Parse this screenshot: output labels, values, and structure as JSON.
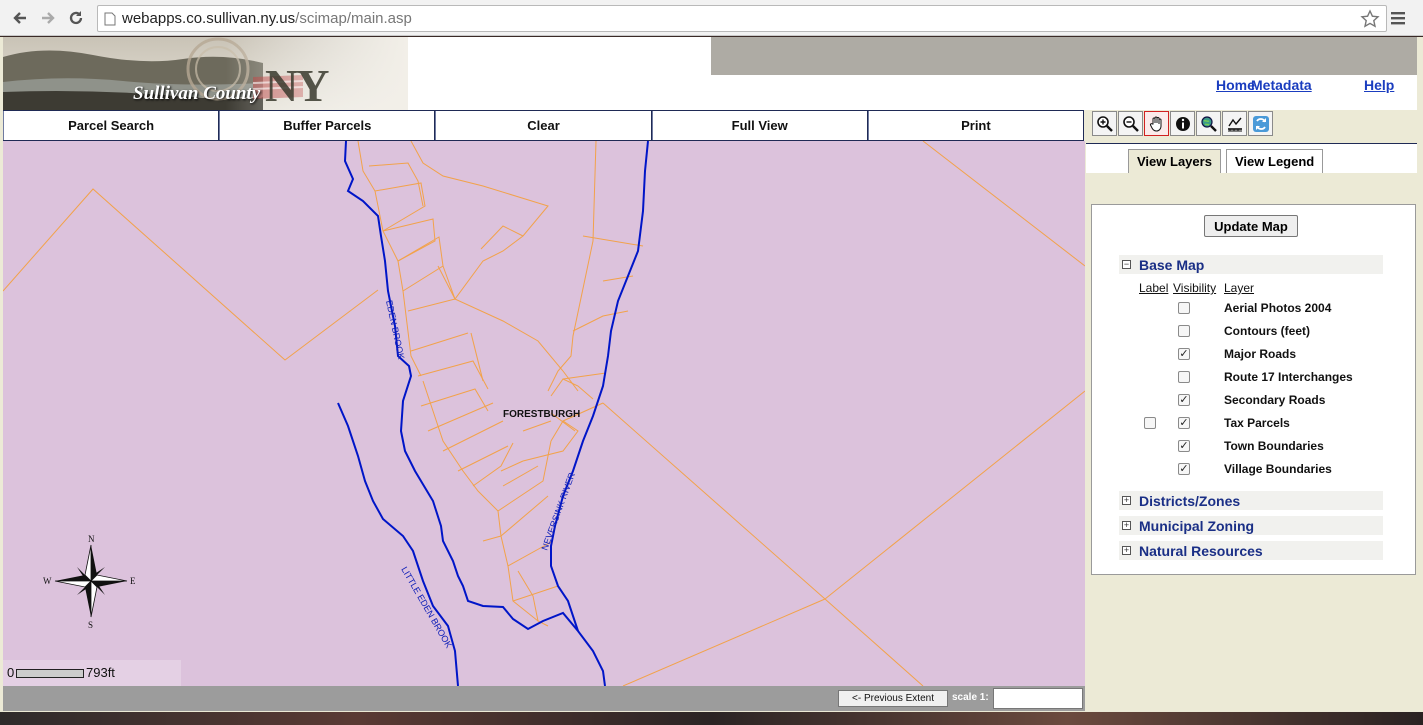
{
  "browser": {
    "url_host": "webapps.co.sullivan.ny.us",
    "url_path": "/scimap/main.asp"
  },
  "header": {
    "banner_text": "Sullivan County",
    "banner_ny": "NY",
    "links": [
      "Home",
      "Metadata",
      "Help"
    ]
  },
  "toolbar": {
    "buttons": [
      "Parcel Search",
      "Buffer Parcels",
      "Clear",
      "Full View",
      "Print"
    ]
  },
  "map": {
    "place_label": "FORESTBURGH",
    "streams": [
      "EDEN BROOK",
      "NEVERSINK RIVER",
      "LITTLE EDEN BROOK"
    ],
    "compass": {
      "n": "N",
      "s": "S",
      "e": "E",
      "w": "W"
    },
    "scalebar": {
      "start": "0",
      "end": "793ft"
    }
  },
  "bottom": {
    "prev_extent_label": "<- Previous Extent",
    "scale_label": "scale 1:",
    "scale_value": ""
  },
  "panel": {
    "tools": [
      "zoom-in",
      "zoom-out",
      "pan",
      "identify",
      "query",
      "measure",
      "refresh"
    ],
    "tabs": [
      "View Layers",
      "View Legend"
    ],
    "update_label": "Update Map",
    "base_map": {
      "title": "Base Map",
      "col_label": "Label",
      "col_visibility": "Visibility",
      "col_layer": "Layer",
      "layers": [
        {
          "name": "Aerial Photos 2004",
          "label": false,
          "visible": false
        },
        {
          "name": "Contours (feet)",
          "label": false,
          "visible": false
        },
        {
          "name": "Major Roads",
          "label": false,
          "visible": true
        },
        {
          "name": "Route 17 Interchanges",
          "label": false,
          "visible": false
        },
        {
          "name": "Secondary Roads",
          "label": false,
          "visible": true
        },
        {
          "name": "Tax Parcels",
          "label": false,
          "visible": true,
          "has_label_box": true
        },
        {
          "name": "Town Boundaries",
          "label": false,
          "visible": true
        },
        {
          "name": "Village Boundaries",
          "label": false,
          "visible": true
        }
      ]
    },
    "groups": [
      "Districts/Zones",
      "Municipal Zoning",
      "Natural Resources"
    ]
  }
}
